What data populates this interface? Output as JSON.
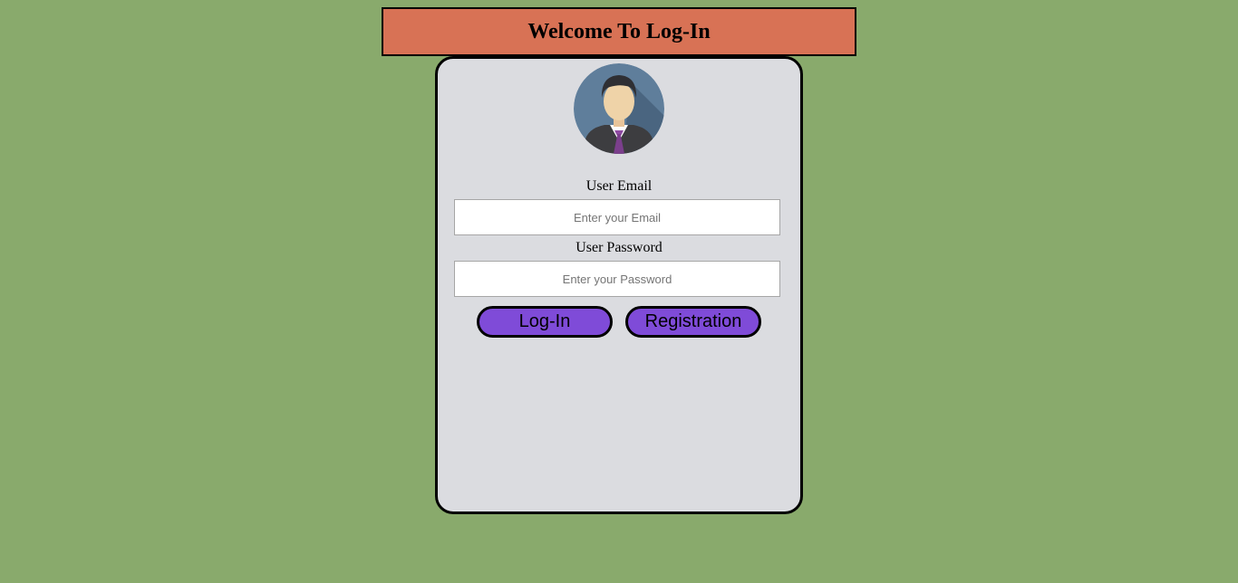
{
  "header": {
    "title": "Welcome To Log-In"
  },
  "form": {
    "avatar_icon": "user-avatar-icon",
    "email_label": "User Email",
    "email_placeholder": "Enter your Email",
    "email_value": "",
    "password_label": "User Password",
    "password_placeholder": "Enter your Password",
    "password_value": "",
    "login_label": "Log-In",
    "register_label": "Registration"
  },
  "colors": {
    "background": "#89aa6c",
    "header": "#d87255",
    "card": "#dbdce0",
    "button": "#7f4bd8"
  }
}
